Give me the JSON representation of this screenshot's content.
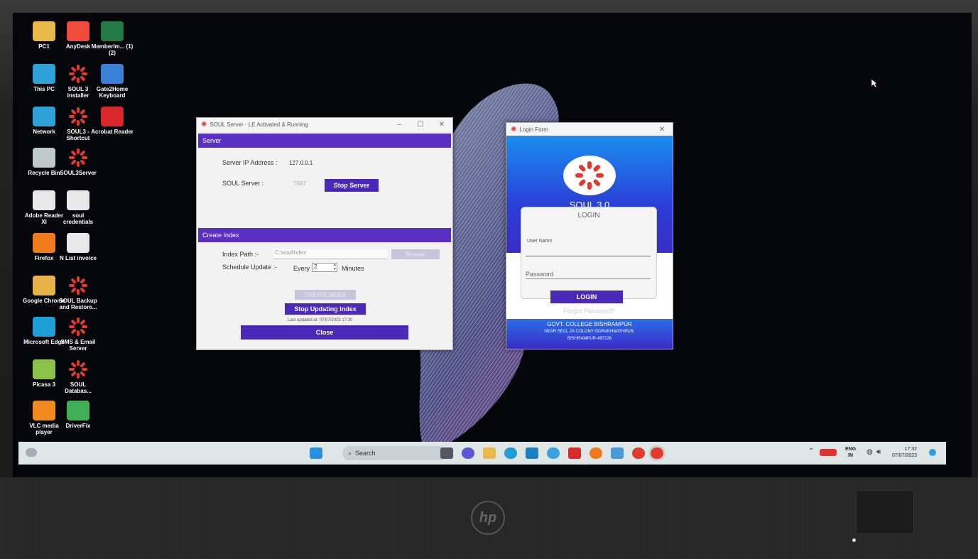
{
  "desktop_icons": [
    {
      "label": "PC1",
      "icon": "folder-icon",
      "color": "#e8b84a"
    },
    {
      "label": "AnyDesk",
      "icon": "anydesk-icon",
      "color": "#ef4b3a"
    },
    {
      "label": "MemberIm... (1) (2)",
      "icon": "excel-icon",
      "color": "#1f7a44"
    },
    {
      "label": "This PC",
      "icon": "monitor-icon",
      "color": "#2fa3d8"
    },
    {
      "label": "SOUL 3 Installer",
      "icon": "soul-icon",
      "color": "#e23b2e"
    },
    {
      "label": "Gate2Home Keyboard",
      "icon": "keyboard-icon",
      "color": "#3a7fd8"
    },
    {
      "label": "Network",
      "icon": "network-icon",
      "color": "#2fa3d8"
    },
    {
      "label": "SOUL3 - Shortcut",
      "icon": "soul-icon",
      "color": "#e23b2e"
    },
    {
      "label": "Acrobat Reader",
      "icon": "acrobat-icon",
      "color": "#d8282c"
    },
    {
      "label": "Recycle Bin",
      "icon": "recycle-bin-icon",
      "color": "#bfc8cc"
    },
    {
      "label": "SOUL3Server",
      "icon": "soul-icon",
      "color": "#e23b2e"
    },
    {
      "label": "Adobe Reader XI",
      "icon": "file-icon",
      "color": "#e8e8e8"
    },
    {
      "label": "soul credentials",
      "icon": "file-icon",
      "color": "#e8e8e8"
    },
    {
      "label": "Firefox",
      "icon": "firefox-icon",
      "color": "#ef7b1e"
    },
    {
      "label": "N List invoice",
      "icon": "document-icon",
      "color": "#e8e8e8"
    },
    {
      "label": "Google Chrome",
      "icon": "chrome-icon",
      "color": "#e8b44a"
    },
    {
      "label": "SOUL Backup and Restore...",
      "icon": "soul-icon",
      "color": "#e23b2e"
    },
    {
      "label": "Microsoft Edge",
      "icon": "edge-icon",
      "color": "#1e9fd8"
    },
    {
      "label": "SMS & Email Server",
      "icon": "soul-icon",
      "color": "#e23b2e"
    },
    {
      "label": "Picasa 3",
      "icon": "picasa-icon",
      "color": "#8bc34a"
    },
    {
      "label": "SOUL Databas...",
      "icon": "soul-icon",
      "color": "#e23b2e"
    },
    {
      "label": "VLC media player",
      "icon": "vlc-icon",
      "color": "#f08a1c"
    },
    {
      "label": "DriverFix",
      "icon": "driverfix-icon",
      "color": "#3fae55"
    }
  ],
  "server_window": {
    "title": "SOUL Server - LE Activated & Running",
    "server_section": "Server",
    "ip_label": "Server IP Address :",
    "ip_value": "127.0.0.1",
    "port_label": "SOUL Server :",
    "port_value": "7687",
    "stop_server": "Stop Server",
    "index_section": "Create Index",
    "index_path_label": "Index Path :-",
    "index_path_value": "C:\\soulindex",
    "browse": "Browse",
    "schedule_label": "Schedule Update :-",
    "every": "Every",
    "every_value": "2",
    "minutes": "Minutes",
    "create_index": "CREATE INDEX",
    "stop_updating": "Stop Updating Index",
    "last_updated": "Last updated at: 07/07/2023 17:30",
    "close": "Close"
  },
  "login_window": {
    "title": "Login Form",
    "product": "SOUL 3.0",
    "heading": "LOGIN",
    "username_label": "User Name",
    "password_label": "Password",
    "login_button": "LOGIN",
    "forgot": "Forgot Password?",
    "college": "GOVT. COLLEGE BISHRAMPUR",
    "address1": "NEAR SECL 2A COLONY GORAKHNATHPUR,",
    "address2": "BISHRAMPUR-497226"
  },
  "taskbar": {
    "search_placeholder": "Search",
    "lang": "ENG",
    "region": "IN",
    "time": "17:32",
    "date": "07/07/2023"
  },
  "colors": {
    "accent_purple": "#5a30c2",
    "button_purple": "#4a28b8",
    "login_blue": "#1a8ef0"
  }
}
